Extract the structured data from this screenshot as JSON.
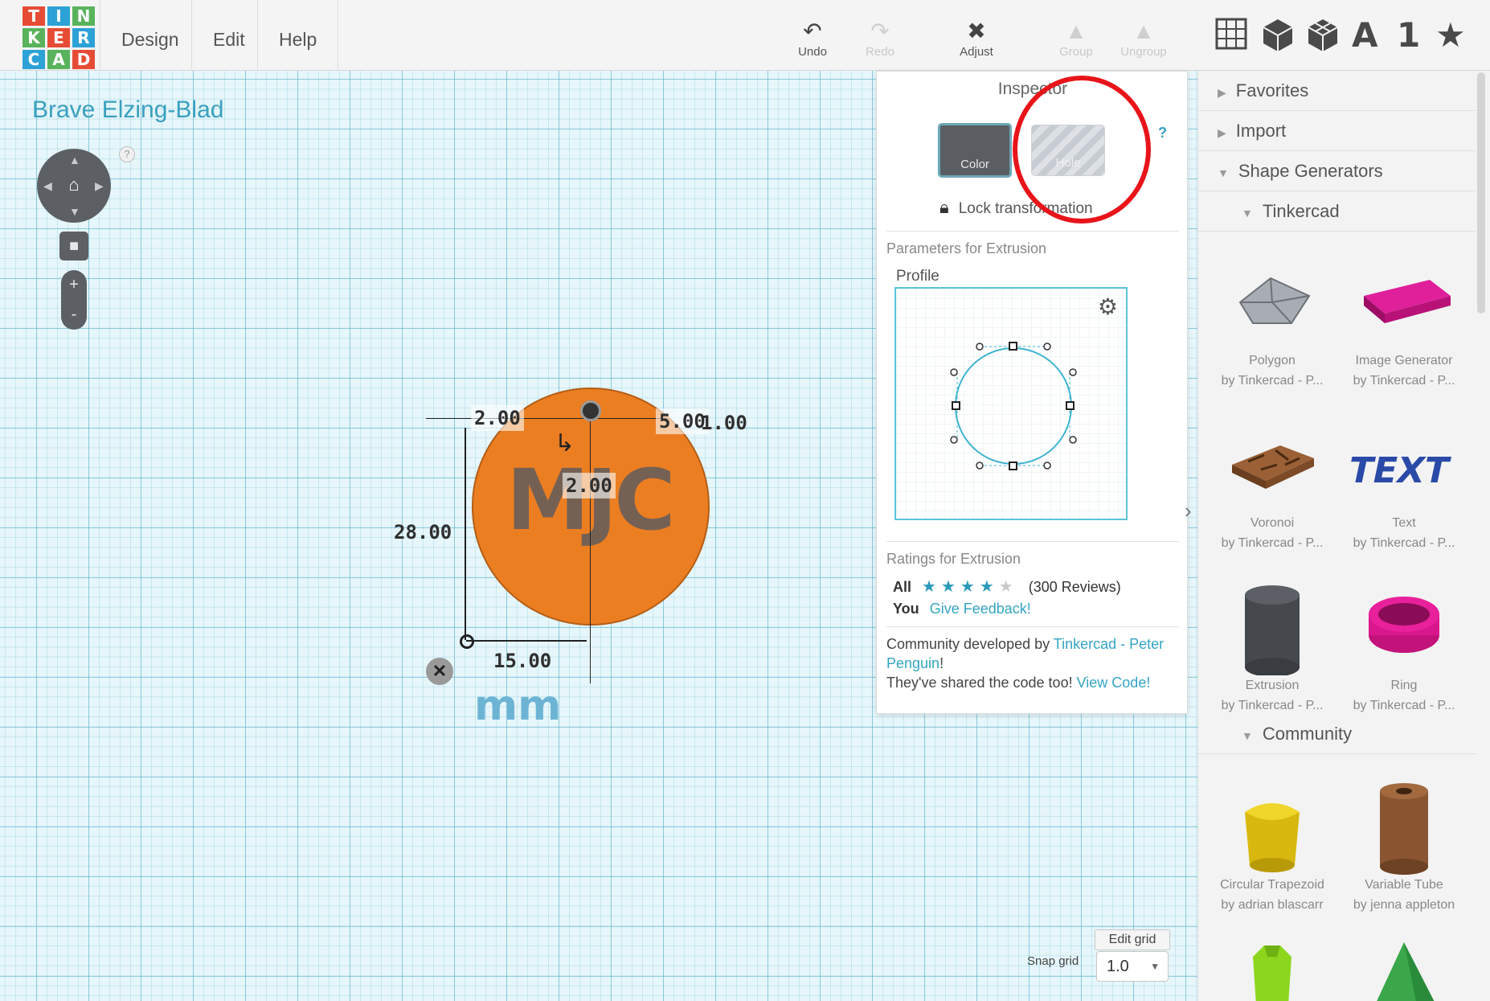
{
  "logo": {
    "letters": [
      "T",
      "I",
      "N",
      "K",
      "E",
      "R",
      "C",
      "A",
      "D"
    ],
    "colors": [
      "#e64c35",
      "#2ca2d6",
      "#59b35c"
    ]
  },
  "menu": {
    "design": "Design",
    "edit": "Edit",
    "help": "Help"
  },
  "toolbar": {
    "undo": "Undo",
    "redo": "Redo",
    "adjust": "Adjust",
    "group": "Group",
    "ungroup": "Ungroup",
    "view_text": "A",
    "view_number": "1"
  },
  "workplane": {
    "design_name": "Brave Elzing-Blad",
    "help": "?",
    "units": "mm",
    "shape_text": "MJC",
    "dimensions": {
      "top_offset": "2.00",
      "top_right": "5.00",
      "right_edge": "1.00",
      "center": "2.00",
      "height": "28.00",
      "width": "15.00"
    },
    "edit_grid": "Edit grid",
    "snap_grid_label": "Snap grid",
    "snap_grid_value": "1.0"
  },
  "inspector": {
    "title": "Inspector",
    "color_btn": "Color",
    "hole_btn": "Hole",
    "help": "?",
    "lock": "Lock transformation",
    "params_title": "Parameters for Extrusion",
    "profile_label": "Profile",
    "ratings_title": "Ratings for Extrusion",
    "all_label": "All",
    "rating": 4,
    "rating_max": 5,
    "reviews": "(300 Reviews)",
    "you_label": "You",
    "feedback_link": "Give Feedback!",
    "community_text": "Community developed by",
    "community_author": "Tinkercad - Peter Penguin",
    "community_excl": "!",
    "shared_text": "They've shared the code too!",
    "view_code": "View Code!"
  },
  "rightpanel": {
    "favorites": "Favorites",
    "import": "Import",
    "shape_generators": "Shape Generators",
    "tinkercad": "Tinkercad",
    "community": "Community",
    "shapes": [
      {
        "name": "Polygon",
        "by": "by Tinkercad - P...",
        "color": "#9aa0a6"
      },
      {
        "name": "Image Generator",
        "by": "by Tinkercad - P...",
        "color": "#d1178c"
      },
      {
        "name": "Voronoi",
        "by": "by Tinkercad - P...",
        "color": "#8a5530"
      },
      {
        "name": "Text",
        "by": "by Tinkercad - P...",
        "color": "#2a4aa8"
      },
      {
        "name": "Extrusion",
        "by": "by Tinkercad - P...",
        "color": "#4a4d52"
      },
      {
        "name": "Ring",
        "by": "by Tinkercad - P...",
        "color": "#d1178c"
      },
      {
        "name": "Circular Trapezoid",
        "by": "by adrian blascarr",
        "color": "#e0c21a"
      },
      {
        "name": "Variable Tube",
        "by": "by jenna appleton",
        "color": "#8a5530"
      }
    ]
  },
  "annotation": {
    "highlight_color": "#e8141a"
  }
}
